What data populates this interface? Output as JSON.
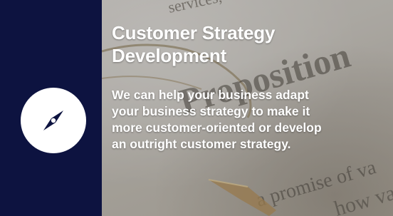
{
  "card": {
    "title_line1": "Customer Strategy",
    "title_line2": "Development",
    "description_line1": "We can help your business adapt",
    "description_line2": "your business strategy to make it",
    "description_line3": "more customer-oriented or develop",
    "description_line4": "an outright customer strategy.",
    "icon": "compass-icon"
  },
  "colors": {
    "panel": "#0d1340",
    "icon_circle": "#ffffff",
    "text": "#ffffff"
  },
  "background_text": {
    "word1": "services,",
    "word2": "Proposition",
    "word3": "a promise of va",
    "word4": "how val"
  }
}
